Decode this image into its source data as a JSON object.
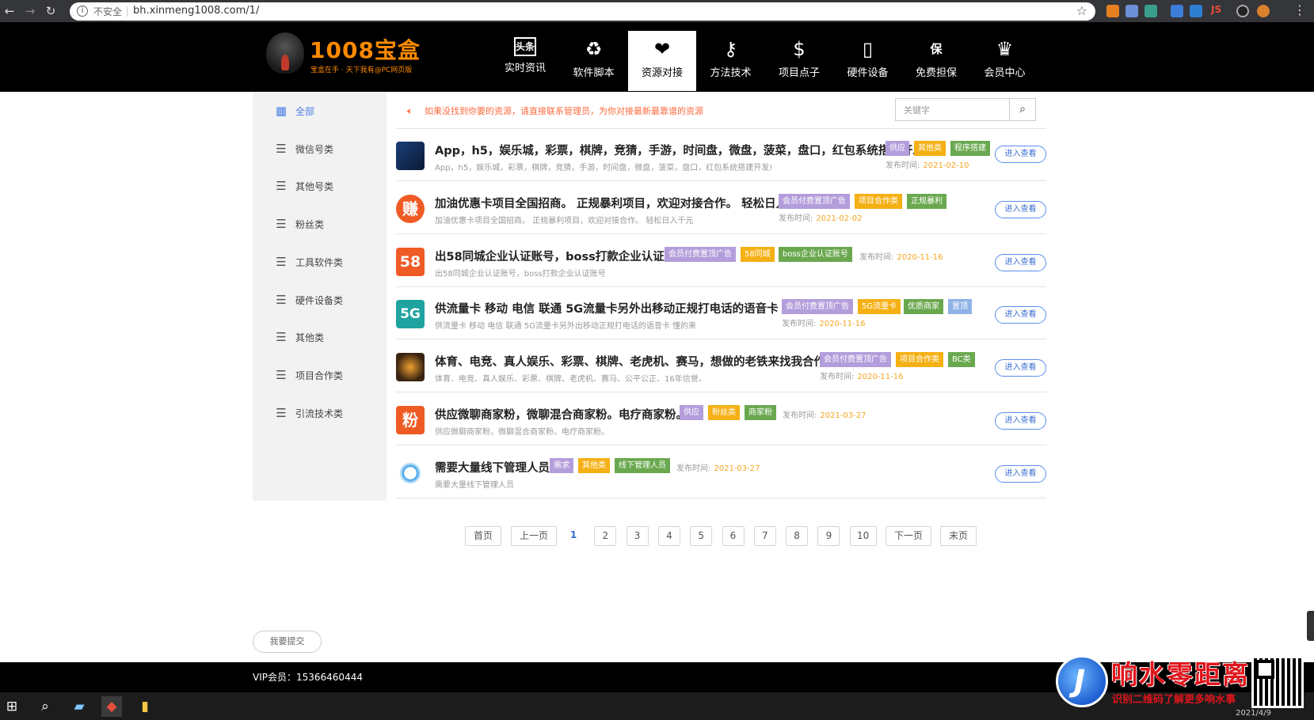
{
  "browser": {
    "insecure_label": "不安全",
    "url": "bh.xinmeng1008.com/1/",
    "ext_js": "JS"
  },
  "header": {
    "logo_title": "1008宝盒",
    "logo_subtitle": "宝盒在手 · 天下我有@PC网页版",
    "nav": [
      {
        "label": "实时资讯",
        "icon": "news-icon",
        "glyph": "头条"
      },
      {
        "label": "软件脚本",
        "icon": "recycle-icon",
        "glyph": "♻"
      },
      {
        "label": "资源对接",
        "icon": "handshake-heart-icon",
        "glyph": "❤"
      },
      {
        "label": "方法技术",
        "icon": "key-icon",
        "glyph": "⚷"
      },
      {
        "label": "项目点子",
        "icon": "dollar-icon",
        "glyph": "$"
      },
      {
        "label": "硬件设备",
        "icon": "devices-icon",
        "glyph": "▯"
      },
      {
        "label": "免费担保",
        "icon": "shield-bao-icon",
        "glyph": "保"
      },
      {
        "label": "会员中心",
        "icon": "member-badge-icon",
        "glyph": "♛"
      }
    ]
  },
  "sidebar": {
    "items": [
      {
        "label": "全部",
        "active": true
      },
      {
        "label": "微信号类"
      },
      {
        "label": "其他号类"
      },
      {
        "label": "粉丝类"
      },
      {
        "label": "工具软件类"
      },
      {
        "label": "硬件设备类"
      },
      {
        "label": "其他类"
      },
      {
        "label": "项目合作类"
      },
      {
        "label": "引流技术类"
      }
    ]
  },
  "notice": "如果没找到你要的资源，请直接联系管理员，为你对接最新最靠谱的资源",
  "search": {
    "placeholder": "关键字"
  },
  "list": [
    {
      "title": "App，h5，娱乐城，彩票，棋牌，竞猜，手游，时间盘，微盘，菠菜，盘口，红包系统搭建开发!",
      "desc": "App，h5，娱乐城，彩票，棋牌，竞猜，手游，时间盘，微盘，菠菜，盘口，红包系统搭建开发!",
      "tags": [
        "供应",
        "其他类",
        "程序搭建"
      ],
      "date_label": "发布时间:",
      "date": "2021-02-10",
      "enter": "进入查看"
    },
    {
      "thumb": "赚",
      "title": "加油优惠卡项目全国招商。 正规暴利项目，欢迎对接合作。 轻松日入千元",
      "desc": "加油优惠卡项目全国招商。 正规暴利项目，欢迎对接合作。 轻松日入千元",
      "tags": [
        "会员付费置顶广告",
        "项目合作类",
        "正规暴利"
      ],
      "date_label": "发布时间:",
      "date": "2021-02-02",
      "enter": "进入查看"
    },
    {
      "thumb": "58",
      "title": "出58同城企业认证账号，boss打款企业认证账号",
      "desc": "出58同城企业认证账号，boss打款企业认证账号",
      "tags": [
        "会员付费置顶广告",
        "58同城",
        "boss企业认证账号"
      ],
      "date_label": "发布时间:",
      "date": "2020-11-16",
      "enter": "进入查看"
    },
    {
      "thumb": "5G",
      "title": "供流量卡 移动 电信 联通 5G流量卡另外出移动正规打电话的语音卡 懂的来",
      "desc": "供流量卡 移动 电信 联通 5G流量卡另外出移动正规打电话的语音卡 懂的来",
      "tags": [
        "会员付费置顶广告",
        "5G流量卡",
        "优质商家",
        "置顶"
      ],
      "date_label": "发布时间:",
      "date": "2020-11-16",
      "enter": "进入查看"
    },
    {
      "title": "体育、电竞、真人娱乐、彩票、棋牌、老虎机、赛马，想做的老铁来找我合作发财",
      "desc": "体育、电竞、真人娱乐、彩票、棋牌、老虎机、赛马、公平公正、16年信誉。",
      "tags": [
        "会员付费置顶广告",
        "项目合作类",
        "BC类"
      ],
      "date_label": "发布时间:",
      "date": "2020-11-16",
      "enter": "进入查看"
    },
    {
      "thumb": "粉",
      "title": "供应微聊商家粉，微聊混合商家粉。电疗商家粉。",
      "desc": "供应微聊商家粉，微聊混合商家粉。电疗商家粉。",
      "tags": [
        "供应",
        "粉丝类",
        "商家粉"
      ],
      "date_label": "发布时间:",
      "date": "2021-03-27",
      "enter": "进入查看"
    },
    {
      "title": "需要大量线下管理人员",
      "desc": "需要大量线下管理人员",
      "tags": [
        "需求",
        "其他类",
        "线下管理人员"
      ],
      "date_label": "发布时间:",
      "date": "2021-03-27",
      "enter": "进入查看"
    }
  ],
  "pagination": {
    "first": "首页",
    "prev": "上一页",
    "pages": [
      "1",
      "2",
      "3",
      "4",
      "5",
      "6",
      "7",
      "8",
      "9",
      "10"
    ],
    "current": "1",
    "next": "下一页",
    "last": "末页"
  },
  "submit_button": "我要提交",
  "footer": {
    "vip": "VIP会员：15366460444"
  },
  "taskbar": {
    "date": "2021/4/9"
  },
  "watermark": {
    "title": "响水零距离",
    "subtitle": "识别二维码了解更多响水事"
  },
  "colors": {
    "header_bg": "#000000",
    "accent_orange": "#ff8a00",
    "tag_purple": "#b39ddb",
    "tag_orange": "#f5b014",
    "tag_green": "#6aa84f",
    "link_blue": "#4a7ee6"
  }
}
